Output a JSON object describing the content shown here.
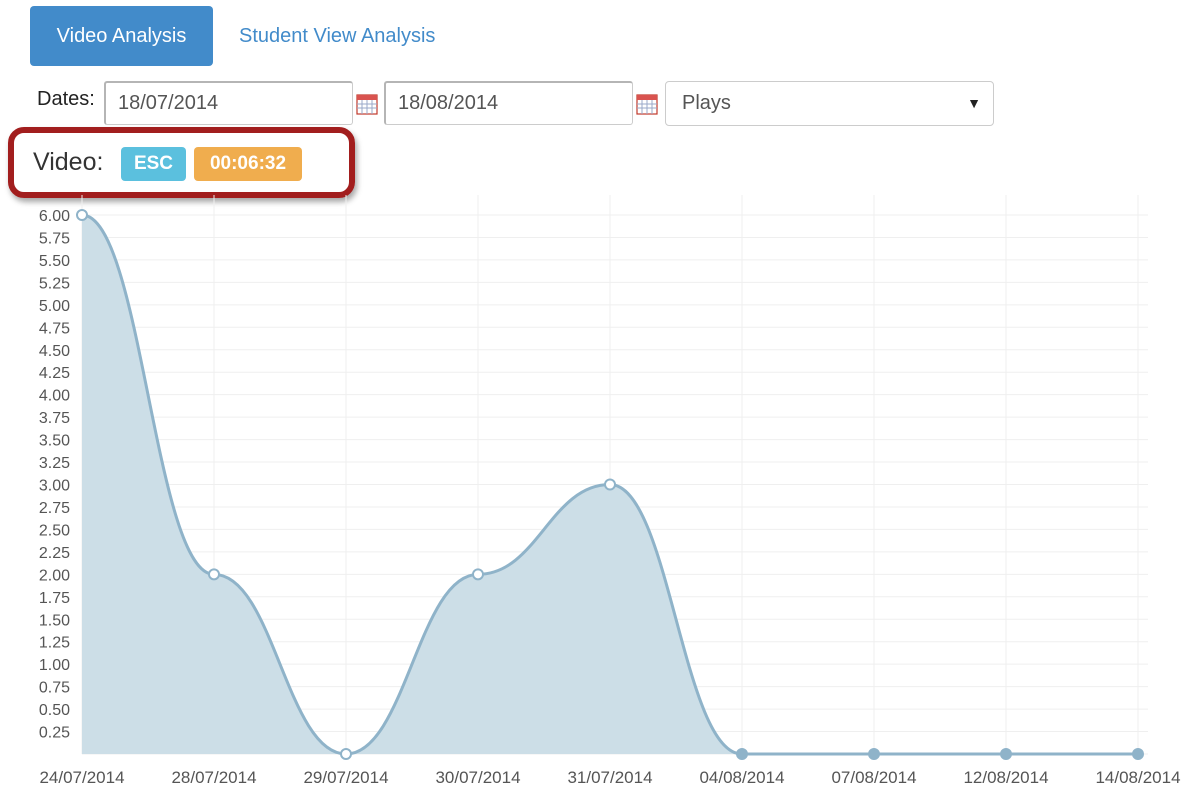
{
  "tabs": {
    "active_label": "Video Analysis",
    "other_label": "Student View Analysis"
  },
  "filters": {
    "dates_label": "Dates:",
    "date_from": "18/07/2014",
    "date_to": "18/08/2014",
    "metric_selected": "Plays"
  },
  "video": {
    "label": "Video:",
    "code_badge": "ESC",
    "duration_badge": "00:06:32"
  },
  "colors": {
    "primary": "#428bca",
    "badge_info": "#5bc0de",
    "badge_warning": "#f0ad4e",
    "highlight": "#a21e1e",
    "series_line": "#8fb3c9",
    "series_fill": "#c9dce6"
  },
  "chart_data": {
    "type": "area",
    "categories": [
      "24/07/2014",
      "28/07/2014",
      "29/07/2014",
      "30/07/2014",
      "31/07/2014",
      "04/08/2014",
      "07/08/2014",
      "12/08/2014",
      "14/08/2014"
    ],
    "values": [
      6,
      2,
      0,
      2,
      3,
      0,
      0,
      0,
      0
    ],
    "ylim": [
      0,
      6
    ],
    "ytick_step": 0.25,
    "yticks": [
      "0.25",
      "0.50",
      "0.75",
      "1.00",
      "1.25",
      "1.50",
      "1.75",
      "2.00",
      "2.25",
      "2.50",
      "2.75",
      "3.00",
      "3.25",
      "3.50",
      "3.75",
      "4.00",
      "4.25",
      "4.50",
      "4.75",
      "5.00",
      "5.25",
      "5.50",
      "5.75",
      "6.00"
    ],
    "grid": true,
    "smooth": true
  }
}
